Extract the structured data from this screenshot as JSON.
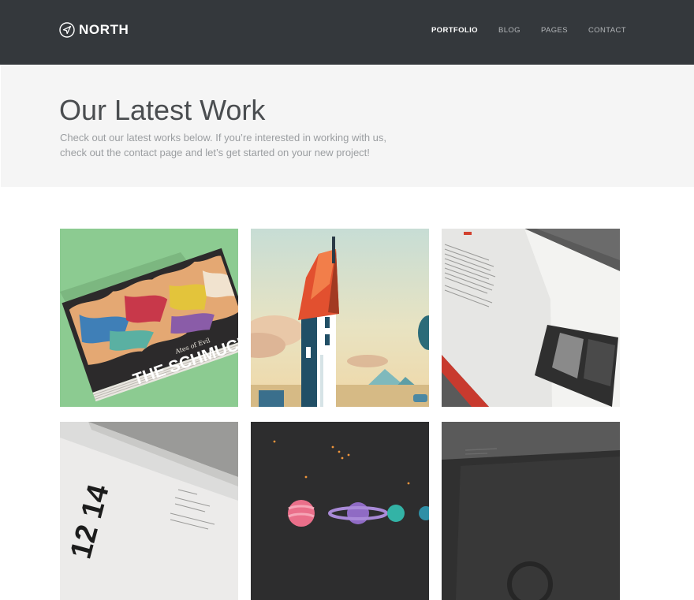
{
  "brand": {
    "name": "NORTH",
    "icon": "paper-plane-icon"
  },
  "nav": {
    "items": [
      {
        "label": "PORTFOLIO",
        "active": true
      },
      {
        "label": "BLOG",
        "active": false
      },
      {
        "label": "PAGES",
        "active": false
      },
      {
        "label": "CONTACT",
        "active": false
      }
    ]
  },
  "hero": {
    "title": "Our Latest Work",
    "line1": "Check out our latest works below. If you’re interested in working with us,",
    "line2": "check out the contact page and let’s get started on your new project!"
  },
  "portfolio": {
    "items": [
      {
        "art": "book-cover",
        "cover_text": "THE SCHMUCKS",
        "cover_subtext": "Ates of Evil"
      },
      {
        "art": "house-illustration"
      },
      {
        "art": "open-brochure"
      },
      {
        "art": "typography-book",
        "cover_text": "12 14"
      },
      {
        "art": "planets-illustration"
      },
      {
        "art": "dark-envelope"
      }
    ]
  },
  "colors": {
    "header_bg": "#34383c",
    "hero_bg": "#f5f5f5",
    "title": "#4a4d50",
    "body_text": "#9a9da0",
    "nav_active": "#ffffff",
    "nav_inactive": "#b3b6b9"
  }
}
